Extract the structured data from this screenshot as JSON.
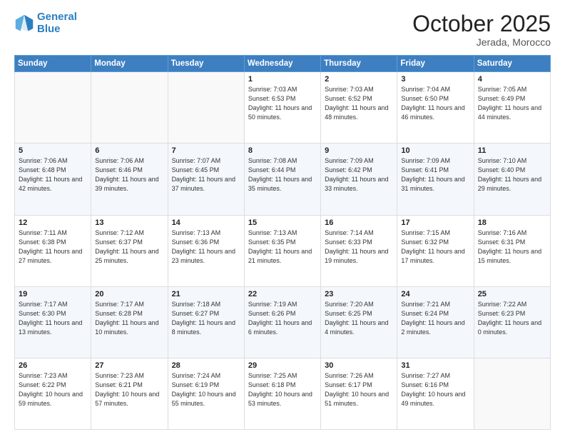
{
  "header": {
    "logo_line1": "General",
    "logo_line2": "Blue",
    "month": "October 2025",
    "location": "Jerada, Morocco"
  },
  "days_of_week": [
    "Sunday",
    "Monday",
    "Tuesday",
    "Wednesday",
    "Thursday",
    "Friday",
    "Saturday"
  ],
  "weeks": [
    [
      {
        "day": "",
        "sunrise": "",
        "sunset": "",
        "daylight": ""
      },
      {
        "day": "",
        "sunrise": "",
        "sunset": "",
        "daylight": ""
      },
      {
        "day": "",
        "sunrise": "",
        "sunset": "",
        "daylight": ""
      },
      {
        "day": "1",
        "sunrise": "Sunrise: 7:03 AM",
        "sunset": "Sunset: 6:53 PM",
        "daylight": "Daylight: 11 hours and 50 minutes."
      },
      {
        "day": "2",
        "sunrise": "Sunrise: 7:03 AM",
        "sunset": "Sunset: 6:52 PM",
        "daylight": "Daylight: 11 hours and 48 minutes."
      },
      {
        "day": "3",
        "sunrise": "Sunrise: 7:04 AM",
        "sunset": "Sunset: 6:50 PM",
        "daylight": "Daylight: 11 hours and 46 minutes."
      },
      {
        "day": "4",
        "sunrise": "Sunrise: 7:05 AM",
        "sunset": "Sunset: 6:49 PM",
        "daylight": "Daylight: 11 hours and 44 minutes."
      }
    ],
    [
      {
        "day": "5",
        "sunrise": "Sunrise: 7:06 AM",
        "sunset": "Sunset: 6:48 PM",
        "daylight": "Daylight: 11 hours and 42 minutes."
      },
      {
        "day": "6",
        "sunrise": "Sunrise: 7:06 AM",
        "sunset": "Sunset: 6:46 PM",
        "daylight": "Daylight: 11 hours and 39 minutes."
      },
      {
        "day": "7",
        "sunrise": "Sunrise: 7:07 AM",
        "sunset": "Sunset: 6:45 PM",
        "daylight": "Daylight: 11 hours and 37 minutes."
      },
      {
        "day": "8",
        "sunrise": "Sunrise: 7:08 AM",
        "sunset": "Sunset: 6:44 PM",
        "daylight": "Daylight: 11 hours and 35 minutes."
      },
      {
        "day": "9",
        "sunrise": "Sunrise: 7:09 AM",
        "sunset": "Sunset: 6:42 PM",
        "daylight": "Daylight: 11 hours and 33 minutes."
      },
      {
        "day": "10",
        "sunrise": "Sunrise: 7:09 AM",
        "sunset": "Sunset: 6:41 PM",
        "daylight": "Daylight: 11 hours and 31 minutes."
      },
      {
        "day": "11",
        "sunrise": "Sunrise: 7:10 AM",
        "sunset": "Sunset: 6:40 PM",
        "daylight": "Daylight: 11 hours and 29 minutes."
      }
    ],
    [
      {
        "day": "12",
        "sunrise": "Sunrise: 7:11 AM",
        "sunset": "Sunset: 6:38 PM",
        "daylight": "Daylight: 11 hours and 27 minutes."
      },
      {
        "day": "13",
        "sunrise": "Sunrise: 7:12 AM",
        "sunset": "Sunset: 6:37 PM",
        "daylight": "Daylight: 11 hours and 25 minutes."
      },
      {
        "day": "14",
        "sunrise": "Sunrise: 7:13 AM",
        "sunset": "Sunset: 6:36 PM",
        "daylight": "Daylight: 11 hours and 23 minutes."
      },
      {
        "day": "15",
        "sunrise": "Sunrise: 7:13 AM",
        "sunset": "Sunset: 6:35 PM",
        "daylight": "Daylight: 11 hours and 21 minutes."
      },
      {
        "day": "16",
        "sunrise": "Sunrise: 7:14 AM",
        "sunset": "Sunset: 6:33 PM",
        "daylight": "Daylight: 11 hours and 19 minutes."
      },
      {
        "day": "17",
        "sunrise": "Sunrise: 7:15 AM",
        "sunset": "Sunset: 6:32 PM",
        "daylight": "Daylight: 11 hours and 17 minutes."
      },
      {
        "day": "18",
        "sunrise": "Sunrise: 7:16 AM",
        "sunset": "Sunset: 6:31 PM",
        "daylight": "Daylight: 11 hours and 15 minutes."
      }
    ],
    [
      {
        "day": "19",
        "sunrise": "Sunrise: 7:17 AM",
        "sunset": "Sunset: 6:30 PM",
        "daylight": "Daylight: 11 hours and 13 minutes."
      },
      {
        "day": "20",
        "sunrise": "Sunrise: 7:17 AM",
        "sunset": "Sunset: 6:28 PM",
        "daylight": "Daylight: 11 hours and 10 minutes."
      },
      {
        "day": "21",
        "sunrise": "Sunrise: 7:18 AM",
        "sunset": "Sunset: 6:27 PM",
        "daylight": "Daylight: 11 hours and 8 minutes."
      },
      {
        "day": "22",
        "sunrise": "Sunrise: 7:19 AM",
        "sunset": "Sunset: 6:26 PM",
        "daylight": "Daylight: 11 hours and 6 minutes."
      },
      {
        "day": "23",
        "sunrise": "Sunrise: 7:20 AM",
        "sunset": "Sunset: 6:25 PM",
        "daylight": "Daylight: 11 hours and 4 minutes."
      },
      {
        "day": "24",
        "sunrise": "Sunrise: 7:21 AM",
        "sunset": "Sunset: 6:24 PM",
        "daylight": "Daylight: 11 hours and 2 minutes."
      },
      {
        "day": "25",
        "sunrise": "Sunrise: 7:22 AM",
        "sunset": "Sunset: 6:23 PM",
        "daylight": "Daylight: 11 hours and 0 minutes."
      }
    ],
    [
      {
        "day": "26",
        "sunrise": "Sunrise: 7:23 AM",
        "sunset": "Sunset: 6:22 PM",
        "daylight": "Daylight: 10 hours and 59 minutes."
      },
      {
        "day": "27",
        "sunrise": "Sunrise: 7:23 AM",
        "sunset": "Sunset: 6:21 PM",
        "daylight": "Daylight: 10 hours and 57 minutes."
      },
      {
        "day": "28",
        "sunrise": "Sunrise: 7:24 AM",
        "sunset": "Sunset: 6:19 PM",
        "daylight": "Daylight: 10 hours and 55 minutes."
      },
      {
        "day": "29",
        "sunrise": "Sunrise: 7:25 AM",
        "sunset": "Sunset: 6:18 PM",
        "daylight": "Daylight: 10 hours and 53 minutes."
      },
      {
        "day": "30",
        "sunrise": "Sunrise: 7:26 AM",
        "sunset": "Sunset: 6:17 PM",
        "daylight": "Daylight: 10 hours and 51 minutes."
      },
      {
        "day": "31",
        "sunrise": "Sunrise: 7:27 AM",
        "sunset": "Sunset: 6:16 PM",
        "daylight": "Daylight: 10 hours and 49 minutes."
      },
      {
        "day": "",
        "sunrise": "",
        "sunset": "",
        "daylight": ""
      }
    ]
  ]
}
